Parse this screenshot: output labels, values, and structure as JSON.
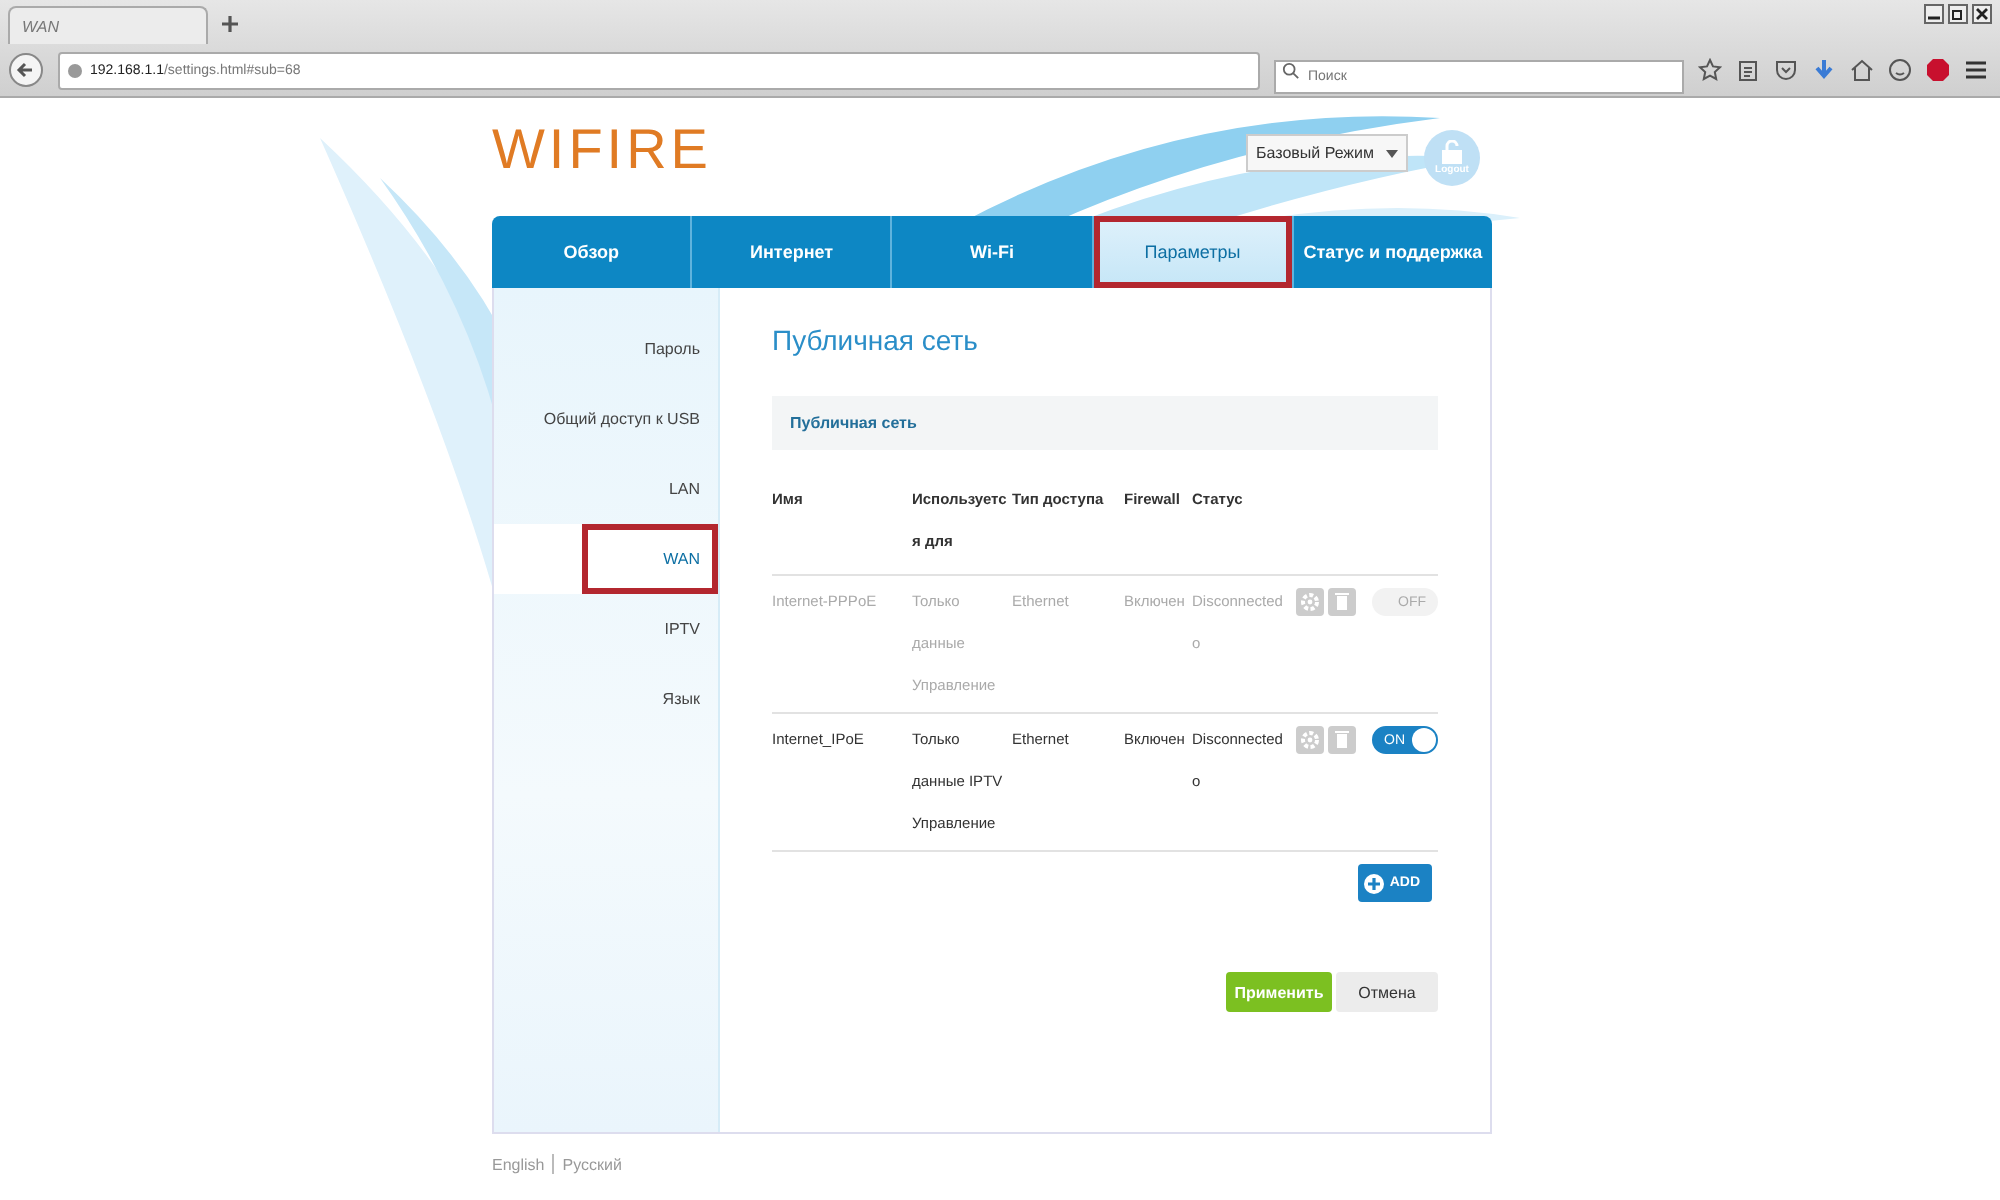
{
  "browser": {
    "tab_title": "WAN",
    "url_host": "192.168.1.1",
    "url_path": "/settings.html#sub=68",
    "search": {
      "placeholder": "Поиск"
    }
  },
  "header": {
    "logo": "WIFIRE",
    "mode_select": "Базовый Режим",
    "logout": "Logout"
  },
  "tabs": [
    {
      "label": "Обзор",
      "selected": false,
      "highlighted": false
    },
    {
      "label": "Интернет",
      "selected": false,
      "highlighted": false
    },
    {
      "label": "Wi-Fi",
      "selected": false,
      "highlighted": false
    },
    {
      "label": "Параметры",
      "selected": true,
      "highlighted": true
    },
    {
      "label": "Статус и поддержка",
      "selected": false,
      "highlighted": false
    }
  ],
  "sidebar": {
    "items": [
      {
        "label": "Пароль",
        "selected": false,
        "highlighted": false
      },
      {
        "label": "Общий доступ к USB",
        "selected": false,
        "highlighted": false
      },
      {
        "label": "LAN",
        "selected": false,
        "highlighted": false
      },
      {
        "label": "WAN",
        "selected": true,
        "highlighted": true
      },
      {
        "label": "IPTV",
        "selected": false,
        "highlighted": false
      },
      {
        "label": "Язык",
        "selected": false,
        "highlighted": false
      }
    ]
  },
  "main": {
    "title": "Публичная сеть",
    "section": "Публичная сеть",
    "table": {
      "columns": [
        "Имя",
        "Используется для",
        "Тип доступа",
        "Firewall",
        "Статус"
      ],
      "rows": [
        {
          "name": "Internet-PPPoE",
          "used_for": "Только данные Управление",
          "access": "Ethernet",
          "firewall": "Включен",
          "status": "Disconnected o",
          "disabled": true,
          "on": false,
          "toggle_label": "OFF"
        },
        {
          "name": "Internet_IPoE",
          "used_for": "Только данные IPTV Управление",
          "access": "Ethernet",
          "firewall": "Включен",
          "status": "Disconnected o",
          "disabled": false,
          "on": true,
          "toggle_label": "ON"
        }
      ]
    },
    "add_button": "ADD",
    "apply_button": "Применить",
    "cancel_button": "Отмена"
  },
  "footer": {
    "languages": [
      "English",
      "Русский"
    ]
  }
}
